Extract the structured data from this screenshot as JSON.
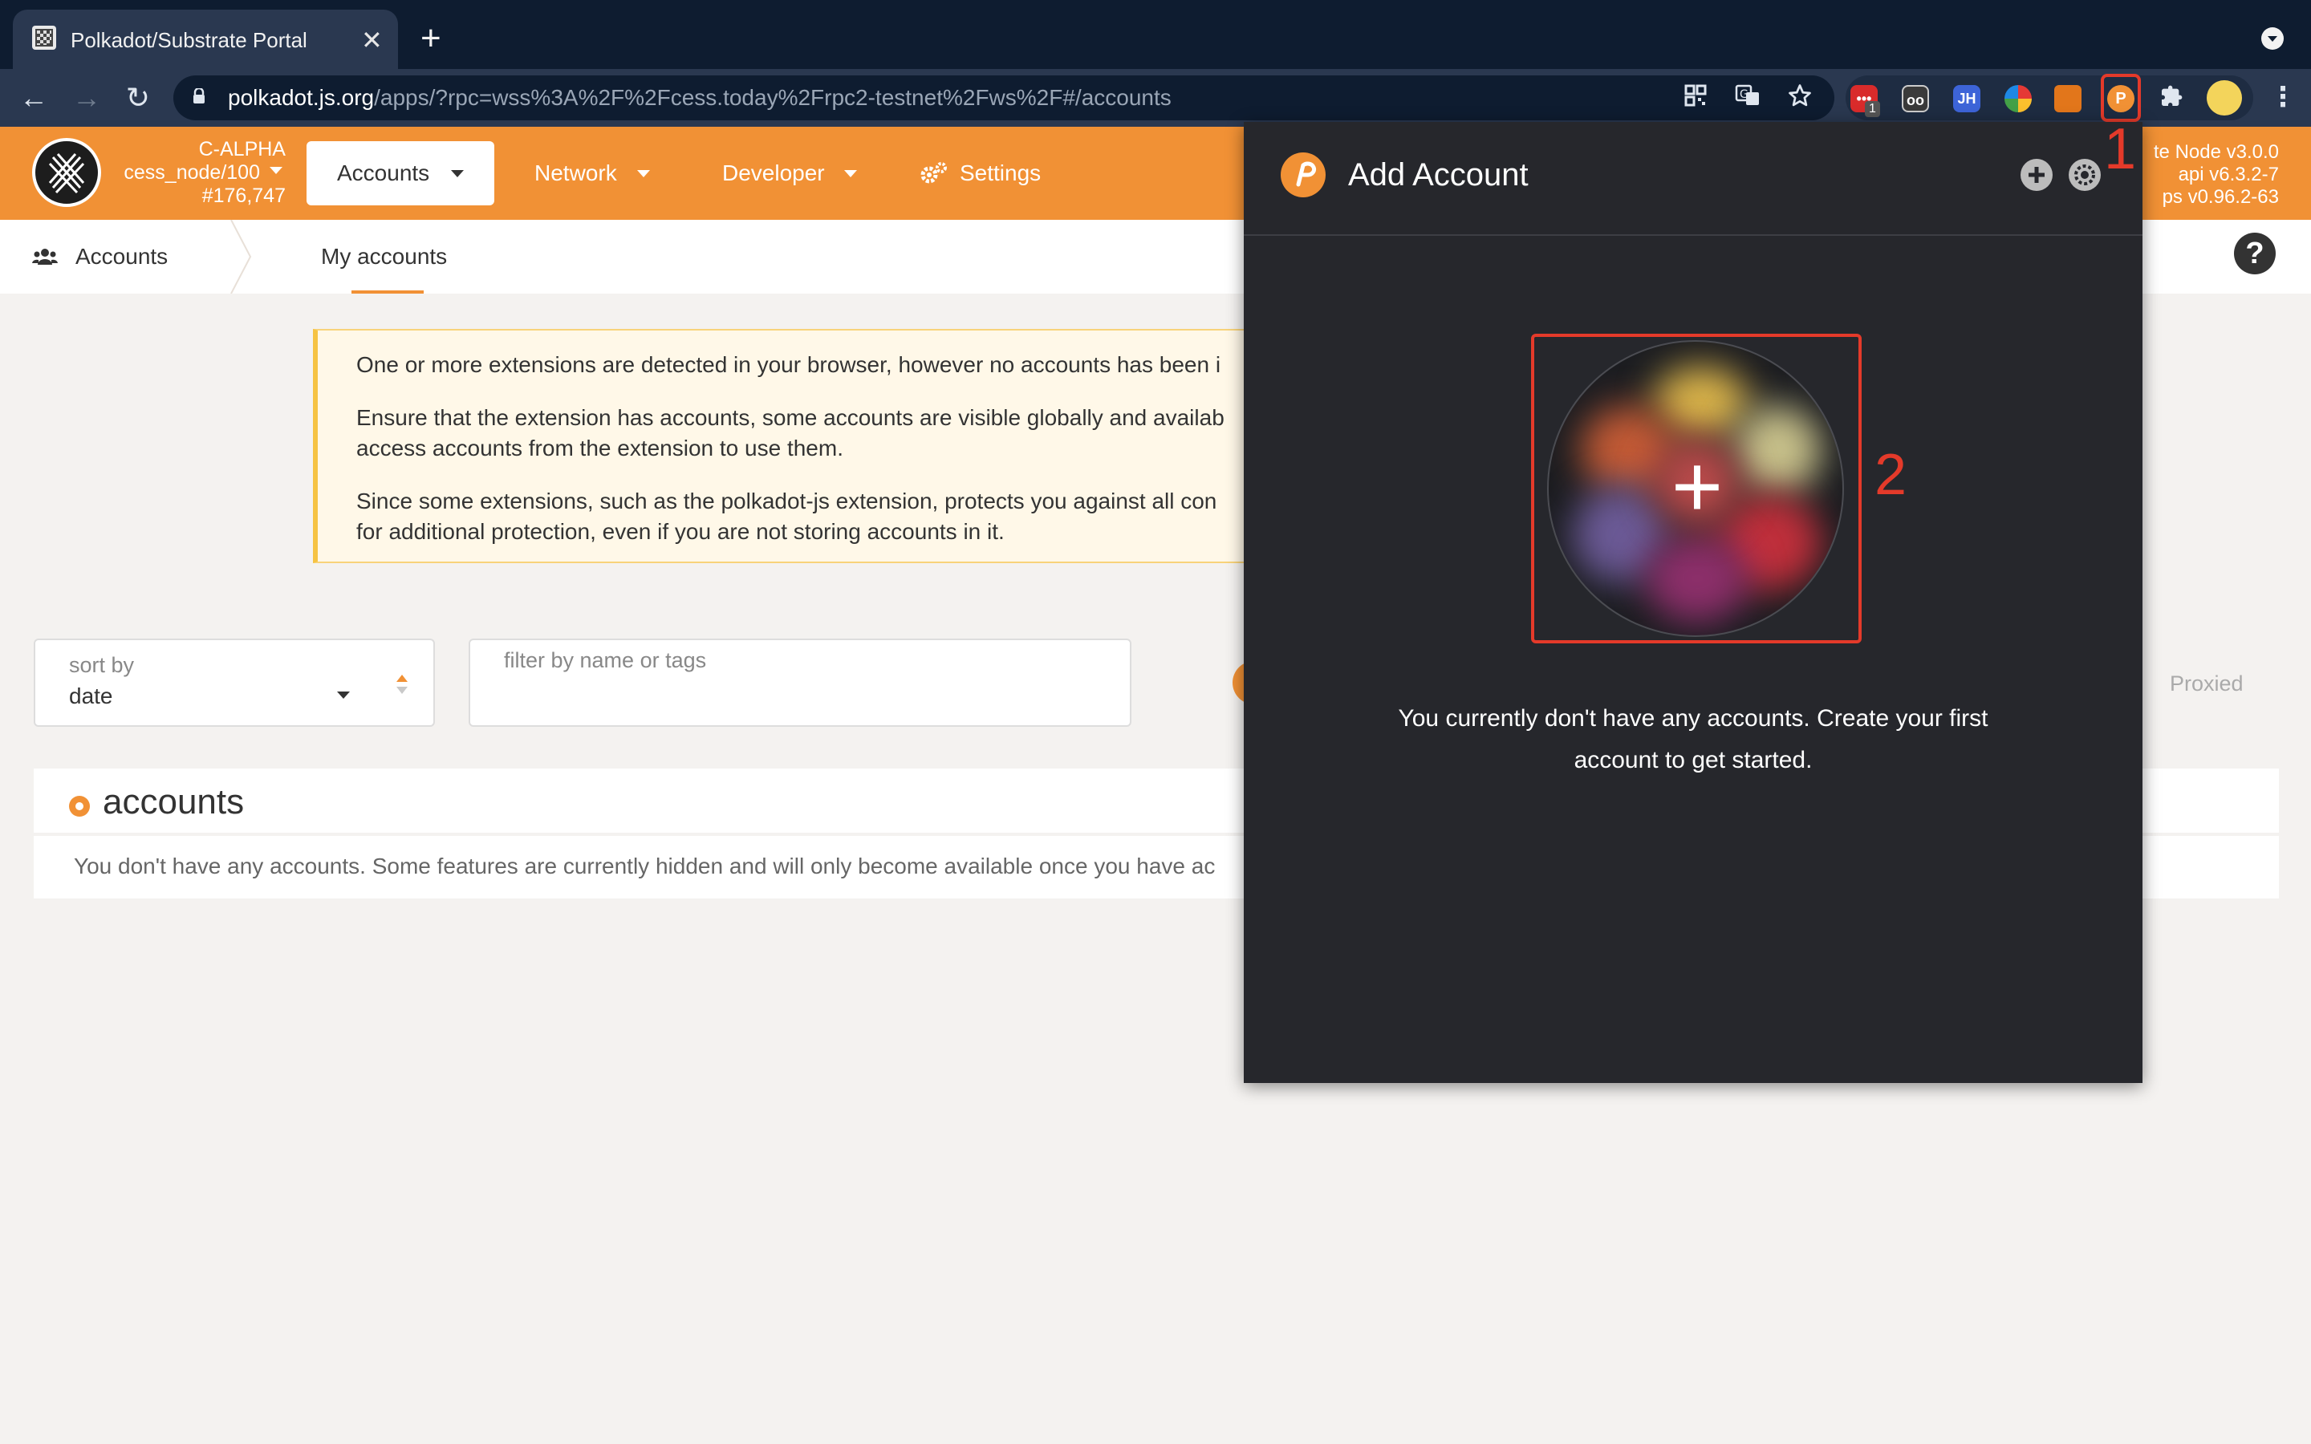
{
  "browser": {
    "tab_title": "Polkadot/Substrate Portal",
    "tab_close": "✕",
    "new_tab": "+",
    "url_host": "polkadot.js.org",
    "url_path": "/apps/?rpc=wss%3A%2F%2Fcess.today%2Frpc2-testnet%2Fws%2F#/accounts",
    "nav_back": "←",
    "nav_forward": "→",
    "nav_reload": "↻",
    "ext_badge": "1",
    "ext_jh": "JH",
    "menu": "⋮"
  },
  "app": {
    "chain": {
      "name": "C-ALPHA",
      "node": "cess_node/100",
      "block": "#176,747"
    },
    "nav": {
      "accounts": "Accounts",
      "network": "Network",
      "developer": "Developer",
      "settings": "Settings"
    },
    "node_info": {
      "line1": "te Node v3.0.0",
      "line2": "api v6.3.2-7",
      "line3": "ps v0.96.2-63"
    },
    "subnav": {
      "accounts": "Accounts",
      "my_accounts": "My accounts",
      "help": "?"
    }
  },
  "warning": {
    "p1": "One or more extensions are detected in your browser, however no accounts has been i",
    "p2_line1": "Ensure that the extension has accounts, some accounts are visible globally and availab",
    "p2_line2": "access accounts from the extension to use them.",
    "p3_line1": "Since some extensions, such as the polkadot-js extension, protects you against all con",
    "p3_line2": "for additional protection, even if you are not storing accounts in it."
  },
  "filters": {
    "sort_label": "sort by",
    "sort_value": "date",
    "filter_placeholder": "filter by name or tags",
    "proxied": "Proxied"
  },
  "accounts_section": {
    "title": "accounts",
    "empty_message": "You don't have any accounts. Some features are currently hidden and will only become available once you have ac"
  },
  "popup": {
    "title": "Add Account",
    "message": "You currently don't have any accounts. Create your first account to get started.",
    "avatar_symbol": "+"
  },
  "annotations": {
    "one": "1",
    "two": "2"
  },
  "colors": {
    "accent": "#f19135",
    "highlight": "#e43a2a",
    "chrome_dark": "#0e1c30",
    "popup_bg": "#26272c"
  }
}
